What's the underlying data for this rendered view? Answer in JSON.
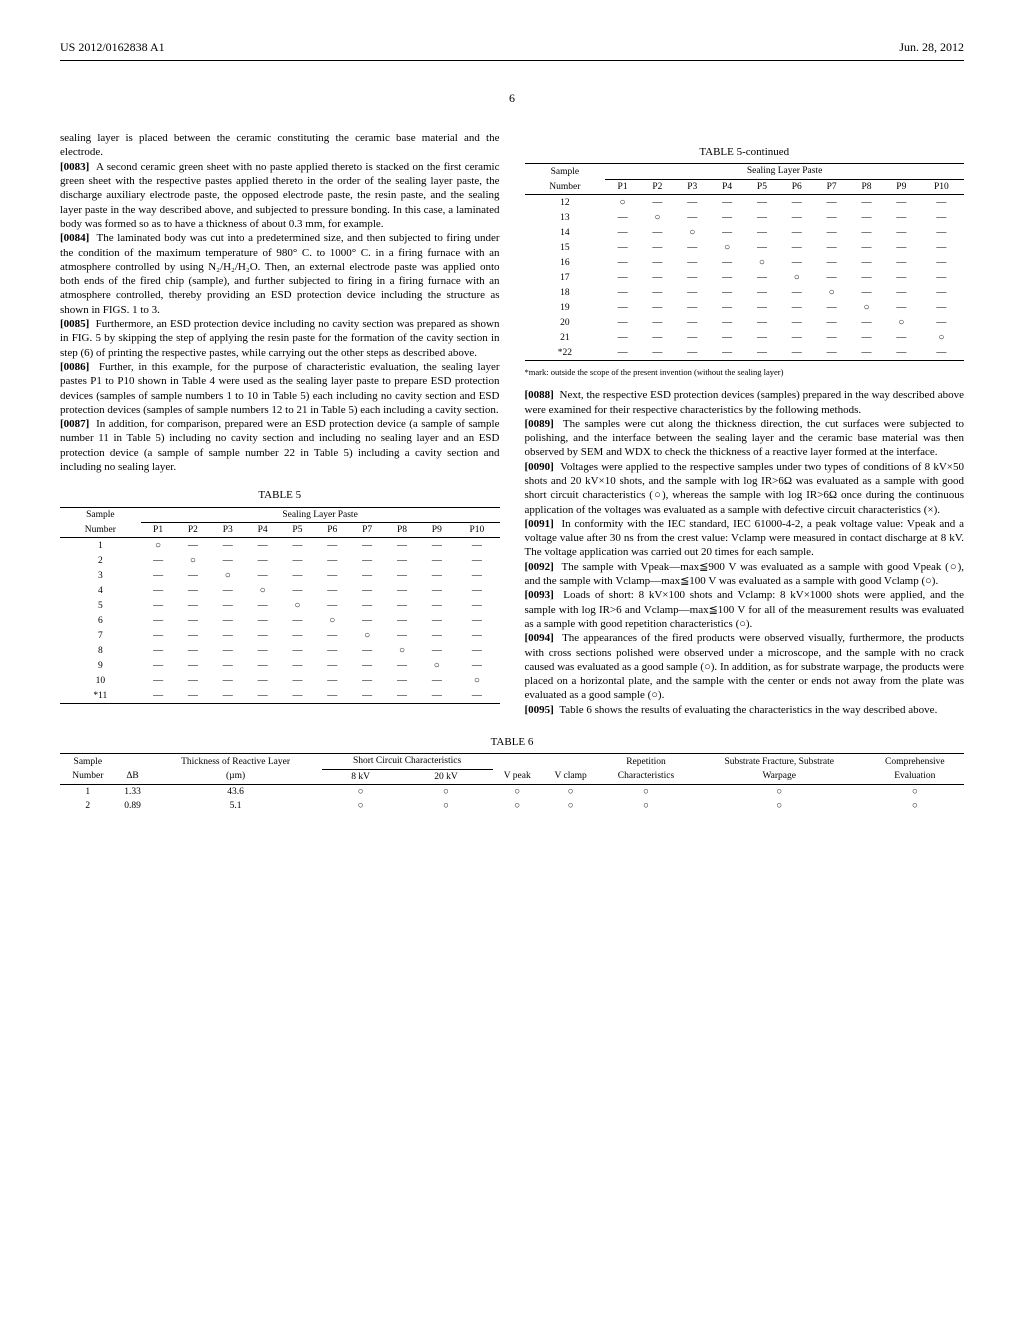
{
  "header": {
    "left": "US 2012/0162838 A1",
    "right": "Jun. 28, 2012"
  },
  "page_number": "6",
  "left_col": {
    "p82_cont": "sealing layer is placed between the ceramic constituting the ceramic base material and the electrode.",
    "p83_num": "[0083]",
    "p83": "A second ceramic green sheet with no paste applied thereto is stacked on the first ceramic green sheet with the respective pastes applied thereto in the order of the sealing layer paste, the discharge auxiliary electrode paste, the opposed electrode paste, the resin paste, and the sealing layer paste in the way described above, and subjected to pressure bonding. In this case, a laminated body was formed so as to have a thickness of about 0.3 mm, for example.",
    "p84_num": "[0084]",
    "p84": "The laminated body was cut into a predetermined size, and then subjected to firing under the condition of the maximum temperature of 980° C. to 1000° C. in a firing furnace with an atmosphere controlled by using N₂/H₂/H₂O. Then, an external electrode paste was applied onto both ends of the fired chip (sample), and further subjected to firing in a firing furnace with an atmosphere controlled, thereby providing an ESD protection device including the structure as shown in FIGS. 1 to 3.",
    "p85_num": "[0085]",
    "p85": "Furthermore, an ESD protection device including no cavity section was prepared as shown in FIG. 5 by skipping the step of applying the resin paste for the formation of the cavity section in step (6) of printing the respective pastes, while carrying out the other steps as described above.",
    "p86_num": "[0086]",
    "p86": "Further, in this example, for the purpose of characteristic evaluation, the sealing layer pastes P1 to P10 shown in Table 4 were used as the sealing layer paste to prepare ESD protection devices (samples of sample numbers 1 to 10 in Table 5) each including no cavity section and ESD protection devices (samples of sample numbers 12 to 21 in Table 5) each including a cavity section.",
    "p87_num": "[0087]",
    "p87": "In addition, for comparison, prepared were an ESD protection device (a sample of sample number 11 in Table 5) including no cavity section and including no sealing layer and an ESD protection device (a sample of sample number 22 in Table 5) including a cavity section and including no sealing layer.",
    "table5_caption": "TABLE 5",
    "table5_span": "Sealing Layer Paste",
    "table5_samplehdr": "Sample",
    "table5_numberhdr": "Number",
    "table5_cols": [
      "P1",
      "P2",
      "P3",
      "P4",
      "P5",
      "P6",
      "P7",
      "P8",
      "P9",
      "P10"
    ],
    "table5_rows_a": [
      {
        "n": "1",
        "marks": [
          "○",
          "—",
          "—",
          "—",
          "—",
          "—",
          "—",
          "—",
          "—",
          "—"
        ]
      },
      {
        "n": "2",
        "marks": [
          "—",
          "○",
          "—",
          "—",
          "—",
          "—",
          "—",
          "—",
          "—",
          "—"
        ]
      },
      {
        "n": "3",
        "marks": [
          "—",
          "—",
          "○",
          "—",
          "—",
          "—",
          "—",
          "—",
          "—",
          "—"
        ]
      },
      {
        "n": "4",
        "marks": [
          "—",
          "—",
          "—",
          "○",
          "—",
          "—",
          "—",
          "—",
          "—",
          "—"
        ]
      },
      {
        "n": "5",
        "marks": [
          "—",
          "—",
          "—",
          "—",
          "○",
          "—",
          "—",
          "—",
          "—",
          "—"
        ]
      },
      {
        "n": "6",
        "marks": [
          "—",
          "—",
          "—",
          "—",
          "—",
          "○",
          "—",
          "—",
          "—",
          "—"
        ]
      },
      {
        "n": "7",
        "marks": [
          "—",
          "—",
          "—",
          "—",
          "—",
          "—",
          "○",
          "—",
          "—",
          "—"
        ]
      },
      {
        "n": "8",
        "marks": [
          "—",
          "—",
          "—",
          "—",
          "—",
          "—",
          "—",
          "○",
          "—",
          "—"
        ]
      },
      {
        "n": "9",
        "marks": [
          "—",
          "—",
          "—",
          "—",
          "—",
          "—",
          "—",
          "—",
          "○",
          "—"
        ]
      },
      {
        "n": "10",
        "marks": [
          "—",
          "—",
          "—",
          "—",
          "—",
          "—",
          "—",
          "—",
          "—",
          "○"
        ]
      },
      {
        "n": "*11",
        "marks": [
          "—",
          "—",
          "—",
          "—",
          "—",
          "—",
          "—",
          "—",
          "—",
          "—"
        ]
      }
    ]
  },
  "right_col": {
    "table5_caption": "TABLE 5-continued",
    "table5_span": "Sealing Layer Paste",
    "table5_samplehdr": "Sample",
    "table5_numberhdr": "Number",
    "table5_cols": [
      "P1",
      "P2",
      "P3",
      "P4",
      "P5",
      "P6",
      "P7",
      "P8",
      "P9",
      "P10"
    ],
    "table5_rows_b": [
      {
        "n": "12",
        "marks": [
          "○",
          "—",
          "—",
          "—",
          "—",
          "—",
          "—",
          "—",
          "—",
          "—"
        ]
      },
      {
        "n": "13",
        "marks": [
          "—",
          "○",
          "—",
          "—",
          "—",
          "—",
          "—",
          "—",
          "—",
          "—"
        ]
      },
      {
        "n": "14",
        "marks": [
          "—",
          "—",
          "○",
          "—",
          "—",
          "—",
          "—",
          "—",
          "—",
          "—"
        ]
      },
      {
        "n": "15",
        "marks": [
          "—",
          "—",
          "—",
          "○",
          "—",
          "—",
          "—",
          "—",
          "—",
          "—"
        ]
      },
      {
        "n": "16",
        "marks": [
          "—",
          "—",
          "—",
          "—",
          "○",
          "—",
          "—",
          "—",
          "—",
          "—"
        ]
      },
      {
        "n": "17",
        "marks": [
          "—",
          "—",
          "—",
          "—",
          "—",
          "○",
          "—",
          "—",
          "—",
          "—"
        ]
      },
      {
        "n": "18",
        "marks": [
          "—",
          "—",
          "—",
          "—",
          "—",
          "—",
          "○",
          "—",
          "—",
          "—"
        ]
      },
      {
        "n": "19",
        "marks": [
          "—",
          "—",
          "—",
          "—",
          "—",
          "—",
          "—",
          "○",
          "—",
          "—"
        ]
      },
      {
        "n": "20",
        "marks": [
          "—",
          "—",
          "—",
          "—",
          "—",
          "—",
          "—",
          "—",
          "○",
          "—"
        ]
      },
      {
        "n": "21",
        "marks": [
          "—",
          "—",
          "—",
          "—",
          "—",
          "—",
          "—",
          "—",
          "—",
          "○"
        ]
      },
      {
        "n": "*22",
        "marks": [
          "—",
          "—",
          "—",
          "—",
          "—",
          "—",
          "—",
          "—",
          "—",
          "—"
        ]
      }
    ],
    "footnote": "*mark: outside the scope of the present invention (without the sealing layer)",
    "p88_num": "[0088]",
    "p88": "Next, the respective ESD protection devices (samples) prepared in the way described above were examined for their respective characteristics by the following methods.",
    "p89_num": "[0089]",
    "p89": "The samples were cut along the thickness direction, the cut surfaces were subjected to polishing, and the interface between the sealing layer and the ceramic base material was then observed by SEM and WDX to check the thickness of a reactive layer formed at the interface.",
    "p90_num": "[0090]",
    "p90": "Voltages were applied to the respective samples under two types of conditions of 8 kV×50 shots and 20 kV×10 shots, and the sample with log IR>6Ω was evaluated as a sample with good short circuit characteristics (○), whereas the sample with log IR>6Ω once during the continuous application of the voltages was evaluated as a sample with defective circuit characteristics (×).",
    "p91_num": "[0091]",
    "p91": "In conformity with the IEC standard, IEC 61000-4-2, a peak voltage value: Vpeak and a voltage value after 30 ns from the crest value: Vclamp were measured in contact discharge at 8 kV. The voltage application was carried out 20 times for each sample.",
    "p92_num": "[0092]",
    "p92": "The sample with Vpeak—max≦900 V was evaluated as a sample with good Vpeak (○), and the sample with Vclamp—max≦100 V was evaluated as a sample with good Vclamp (○).",
    "p93_num": "[0093]",
    "p93": "Loads of short: 8 kV×100 shots and Vclamp: 8 kV×1000 shots were applied, and the sample with log IR>6 and Vclamp—max≦100 V for all of the measurement results was evaluated as a sample with good repetition characteristics (○).",
    "p94_num": "[0094]",
    "p94": "The appearances of the fired products were observed visually, furthermore, the products with cross sections polished were observed under a microscope, and the sample with no crack caused was evaluated as a good sample (○). In addition, as for substrate warpage, the products were placed on a horizontal plate, and the sample with the center or ends not away from the plate was evaluated as a good sample (○).",
    "p95_num": "[0095]",
    "p95": "Table 6 shows the results of evaluating the characteristics in the way described above."
  },
  "table6": {
    "caption": "TABLE 6",
    "headers_top": [
      "Sample",
      "",
      "Thickness of Reactive Layer",
      "Short Circuit Characteristics",
      "",
      "",
      "",
      "Repetition",
      "Substrate Fracture, Substrate",
      "Comprehensive"
    ],
    "headers_bot": [
      "Number",
      "ΔB",
      "(µm)",
      "8 kV",
      "20 kV",
      "V peak",
      "V clamp",
      "Characteristics",
      "Warpage",
      "Evaluation"
    ],
    "rows": [
      {
        "n": "1",
        "db": "1.33",
        "th": "43.6",
        "c": [
          "○",
          "○",
          "○",
          "○",
          "○",
          "○",
          "○"
        ]
      },
      {
        "n": "2",
        "db": "0.89",
        "th": "5.1",
        "c": [
          "○",
          "○",
          "○",
          "○",
          "○",
          "○",
          "○"
        ]
      }
    ]
  },
  "chart_data": [
    {
      "type": "table",
      "title": "TABLE 5 - Sealing Layer Paste (samples 1-11)",
      "columns": [
        "Number",
        "P1",
        "P2",
        "P3",
        "P4",
        "P5",
        "P6",
        "P7",
        "P8",
        "P9",
        "P10"
      ],
      "rows": [
        [
          "1",
          "○",
          "—",
          "—",
          "—",
          "—",
          "—",
          "—",
          "—",
          "—",
          "—"
        ],
        [
          "2",
          "—",
          "○",
          "—",
          "—",
          "—",
          "—",
          "—",
          "—",
          "—",
          "—"
        ],
        [
          "3",
          "—",
          "—",
          "○",
          "—",
          "—",
          "—",
          "—",
          "—",
          "—",
          "—"
        ],
        [
          "4",
          "—",
          "—",
          "—",
          "○",
          "—",
          "—",
          "—",
          "—",
          "—",
          "—"
        ],
        [
          "5",
          "—",
          "—",
          "—",
          "—",
          "○",
          "—",
          "—",
          "—",
          "—",
          "—"
        ],
        [
          "6",
          "—",
          "—",
          "—",
          "—",
          "—",
          "○",
          "—",
          "—",
          "—",
          "—"
        ],
        [
          "7",
          "—",
          "—",
          "—",
          "—",
          "—",
          "—",
          "○",
          "—",
          "—",
          "—"
        ],
        [
          "8",
          "—",
          "—",
          "—",
          "—",
          "—",
          "—",
          "—",
          "○",
          "—",
          "—"
        ],
        [
          "9",
          "—",
          "—",
          "—",
          "—",
          "—",
          "—",
          "—",
          "—",
          "○",
          "—"
        ],
        [
          "10",
          "—",
          "—",
          "—",
          "—",
          "—",
          "—",
          "—",
          "—",
          "—",
          "○"
        ],
        [
          "*11",
          "—",
          "—",
          "—",
          "—",
          "—",
          "—",
          "—",
          "—",
          "—",
          "—"
        ]
      ]
    },
    {
      "type": "table",
      "title": "TABLE 5-continued - Sealing Layer Paste (samples 12-22)",
      "columns": [
        "Number",
        "P1",
        "P2",
        "P3",
        "P4",
        "P5",
        "P6",
        "P7",
        "P8",
        "P9",
        "P10"
      ],
      "rows": [
        [
          "12",
          "○",
          "—",
          "—",
          "—",
          "—",
          "—",
          "—",
          "—",
          "—",
          "—"
        ],
        [
          "13",
          "—",
          "○",
          "—",
          "—",
          "—",
          "—",
          "—",
          "—",
          "—",
          "—"
        ],
        [
          "14",
          "—",
          "—",
          "○",
          "—",
          "—",
          "—",
          "—",
          "—",
          "—",
          "—"
        ],
        [
          "15",
          "—",
          "—",
          "—",
          "○",
          "—",
          "—",
          "—",
          "—",
          "—",
          "—"
        ],
        [
          "16",
          "—",
          "—",
          "—",
          "—",
          "○",
          "—",
          "—",
          "—",
          "—",
          "—"
        ],
        [
          "17",
          "—",
          "—",
          "—",
          "—",
          "—",
          "○",
          "—",
          "—",
          "—",
          "—"
        ],
        [
          "18",
          "—",
          "—",
          "—",
          "—",
          "—",
          "—",
          "○",
          "—",
          "—",
          "—"
        ],
        [
          "19",
          "—",
          "—",
          "—",
          "—",
          "—",
          "—",
          "—",
          "○",
          "—",
          "—"
        ],
        [
          "20",
          "—",
          "—",
          "—",
          "—",
          "—",
          "—",
          "—",
          "—",
          "○",
          "—"
        ],
        [
          "21",
          "—",
          "—",
          "—",
          "—",
          "—",
          "—",
          "—",
          "—",
          "—",
          "○"
        ],
        [
          "*22",
          "—",
          "—",
          "—",
          "—",
          "—",
          "—",
          "—",
          "—",
          "—",
          "—"
        ]
      ]
    },
    {
      "type": "table",
      "title": "TABLE 6 - Characteristics evaluation",
      "columns": [
        "Sample Number",
        "ΔB",
        "Thickness of Reactive Layer (µm)",
        "Short Circuit 8 kV",
        "Short Circuit 20 kV",
        "V peak",
        "V clamp",
        "Repetition Characteristics",
        "Substrate Fracture, Substrate Warpage",
        "Comprehensive Evaluation"
      ],
      "rows": [
        [
          "1",
          "1.33",
          "43.6",
          "○",
          "○",
          "○",
          "○",
          "○",
          "○",
          "○"
        ],
        [
          "2",
          "0.89",
          "5.1",
          "○",
          "○",
          "○",
          "○",
          "○",
          "○",
          "○"
        ]
      ]
    }
  ]
}
